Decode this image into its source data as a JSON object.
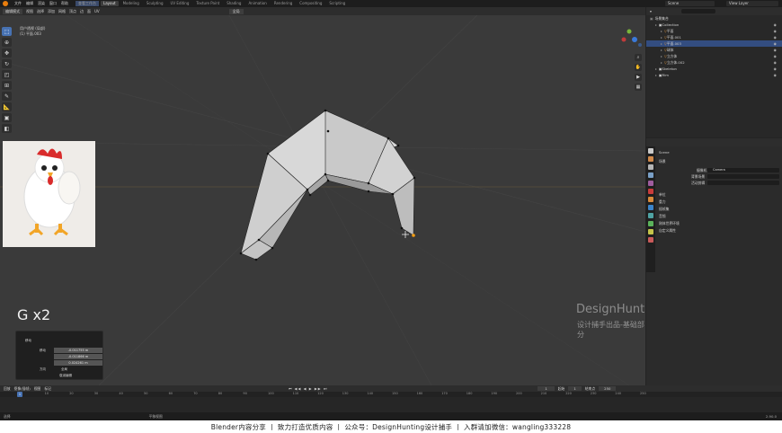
{
  "topbar": {
    "menu": [
      "文件",
      "编辑",
      "渲染",
      "窗口",
      "帮助"
    ],
    "workspace_tabs": [
      "Layout",
      "Modeling",
      "Sculpting",
      "UV Editing",
      "Texture Paint",
      "Shading",
      "Animation",
      "Rendering",
      "Compositing",
      "Scripting"
    ],
    "active_tab": "Layout",
    "extra_tab": "查看工作台",
    "scene": "Scene",
    "view_layer": "View Layer"
  },
  "viewport": {
    "mode": "编辑模式",
    "header_menus": [
      "视图",
      "选择",
      "添加",
      "网格",
      "顶点",
      "边",
      "面",
      "UV"
    ],
    "orientation": "全局",
    "view_name": "用户透视 (局部)",
    "object_name": "(1) 平面.003",
    "keycast": "G x2",
    "watermark_title": "DesignHunting",
    "watermark_sub": "设计捕手出品-基础部分"
  },
  "operator_panel": {
    "title": "移动",
    "label_move": "移动",
    "values": [
      "-0.011755 m",
      "-0.011866 m",
      "0.024261 m"
    ],
    "orient_label": "方向",
    "orient_value": "全局",
    "proportional": "衰减编辑"
  },
  "outliner": {
    "title": "场景集合",
    "rows": [
      {
        "label": "Collection",
        "indent": 1,
        "selected": false
      },
      {
        "label": "平面",
        "indent": 2,
        "selected": false
      },
      {
        "label": "平面.001",
        "indent": 2,
        "selected": false
      },
      {
        "label": "平面.003",
        "indent": 2,
        "selected": true
      },
      {
        "label": "球体",
        "indent": 2,
        "selected": false
      },
      {
        "label": "立方体",
        "indent": 2,
        "selected": false
      },
      {
        "label": "立方体.002",
        "indent": 2,
        "selected": false
      },
      {
        "label": "Skeleton",
        "indent": 1,
        "selected": false
      },
      {
        "label": "Rim",
        "indent": 1,
        "selected": false
      }
    ]
  },
  "properties": {
    "scene_label": "Scene",
    "section_scene": "场景",
    "camera_label": "摄像机",
    "camera_value": "Camera",
    "background_scene_label": "背景场景",
    "active_clip_label": "活动剪辑",
    "units": "单位",
    "gravity": "重力",
    "keying_sets": "插帧集",
    "audio": "音频",
    "rigid_body_world": "刚体世界环境",
    "custom_props": "自定义属性"
  },
  "timeline": {
    "menus": [
      "回放",
      "抠像(插帧)",
      "视图",
      "标记"
    ],
    "current_frame": "1",
    "start_label": "起始",
    "start": "1",
    "end_label": "结束点",
    "end": "250",
    "ticks": [
      "0",
      "10",
      "20",
      "30",
      "40",
      "50",
      "60",
      "70",
      "80",
      "90",
      "100",
      "110",
      "120",
      "130",
      "140",
      "150",
      "160",
      "170",
      "180",
      "190",
      "200",
      "210",
      "220",
      "230",
      "240",
      "250"
    ]
  },
  "statusbar": {
    "left": "选择",
    "mid": "平移视图",
    "version": "2.90.0"
  },
  "banner": "Blender内容分享  丨  致力打造优质内容  丨  公众号：DesignHunting设计捕手  丨  入群请加微信：wangling333228",
  "colors": {
    "viewport_bg": "#3a3a3a",
    "selected_row": "#334d80",
    "accent_blue": "#4772b3",
    "orange": "#e87d0d",
    "mesh_face": "#d9d9d9"
  }
}
